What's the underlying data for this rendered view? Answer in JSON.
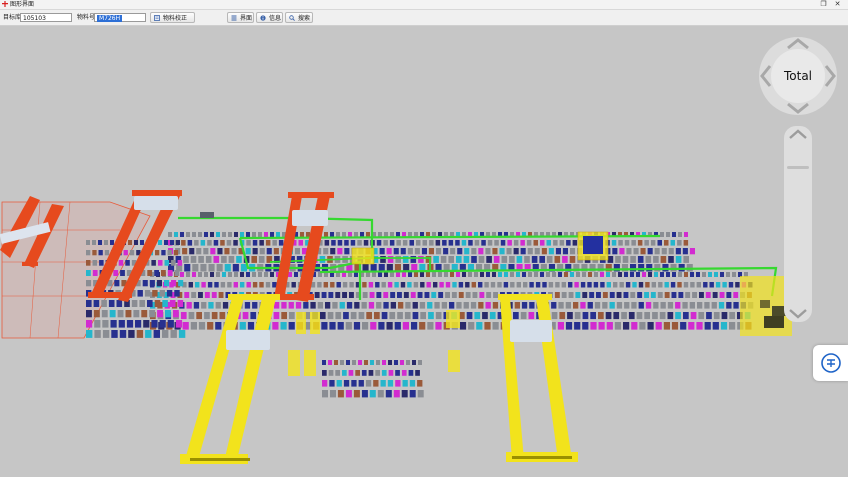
{
  "window": {
    "title": "图形界面",
    "controls": {
      "restore": "❐",
      "close": "✕"
    }
  },
  "toolbar": {
    "target_label": "目标库区",
    "target_value": "105103",
    "material_label": "物料号",
    "material_value": "M726H",
    "buttons": [
      {
        "label": "物料校正",
        "icon": "material-correction-icon"
      },
      {
        "label": "界面",
        "icon": "interface-icon"
      },
      {
        "label": "信息",
        "icon": "info-icon"
      },
      {
        "label": "搜索",
        "icon": "search-icon"
      }
    ]
  },
  "navigation": {
    "center_label": "Total"
  },
  "colors": {
    "floor": "#c6c6c6",
    "crane_orange": "#e64a1e",
    "crane_yellow": "#f2e31c",
    "route_green": "#36d830",
    "coil_blue": "#27308f",
    "coil_gray": "#8a8d93",
    "coil_cyan": "#25b6cc",
    "coil_magenta": "#d22bd0"
  }
}
